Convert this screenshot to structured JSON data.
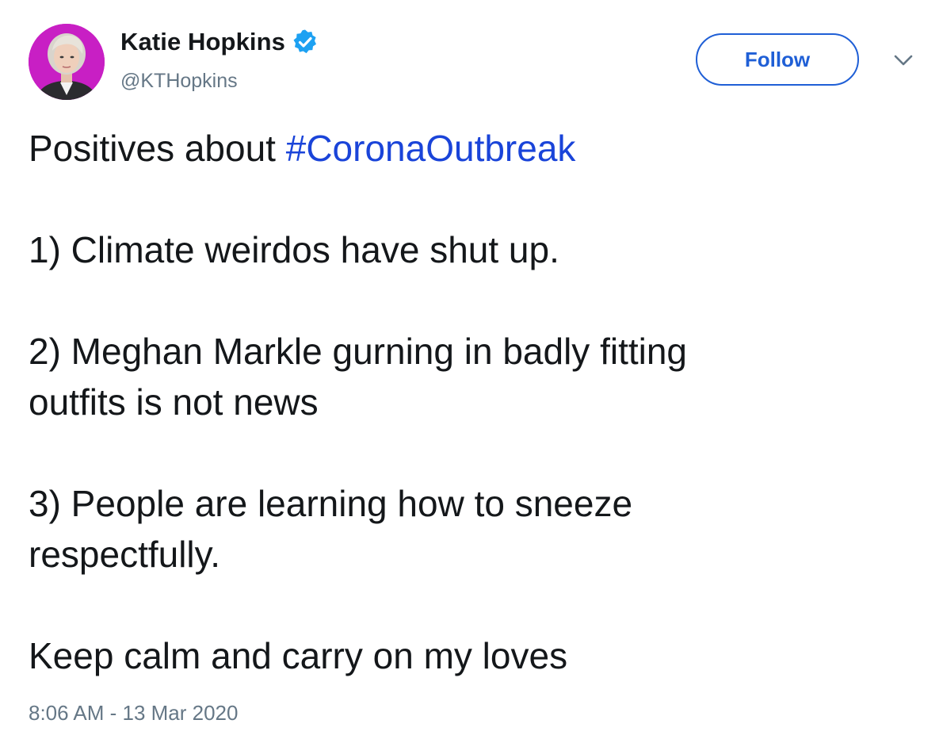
{
  "user": {
    "display_name": "Katie Hopkins",
    "handle": "@KTHopkins",
    "verified": true
  },
  "actions": {
    "follow_label": "Follow",
    "more_icon": "chevron-down-icon"
  },
  "tweet": {
    "intro_text": "Positives about ",
    "hashtag": "#CoronaOutbreak",
    "line1": "1) Climate weirdos have shut up.",
    "line2a": "2) Meghan Markle gurning in badly fitting",
    "line2b": "outfits is not news",
    "line3a": "3) People are learning how to sneeze",
    "line3b": "respectfully.",
    "closing": "Keep calm and carry on my loves"
  },
  "meta": {
    "timestamp": "8:06 AM - 13 Mar 2020"
  },
  "colors": {
    "accent": "#1f5fd6",
    "hashtag": "#1a44d9",
    "verified_badge": "#1da1f2",
    "avatar_background": "#c81fc4",
    "secondary_text": "#657786",
    "primary_text": "#14171a"
  }
}
